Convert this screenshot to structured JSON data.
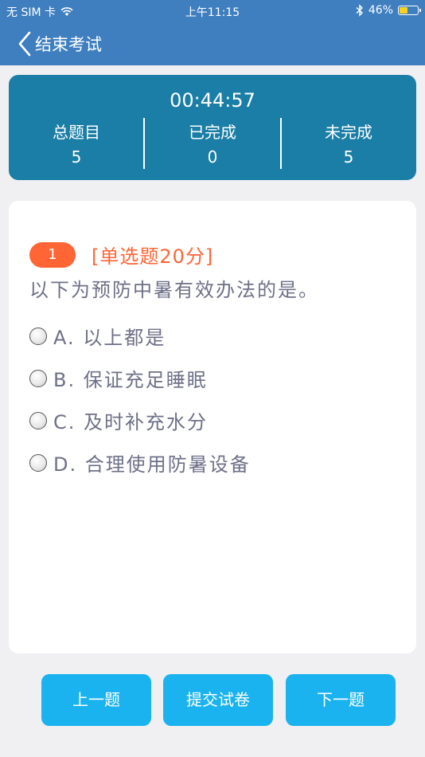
{
  "status_bar": {
    "carrier": "无 SIM 卡",
    "time": "上午11:15",
    "battery_percent": "46%",
    "battery_level": 0.46,
    "icons": [
      "wifi-icon",
      "bluetooth-icon",
      "battery-icon"
    ]
  },
  "nav": {
    "back_label": "结束考试"
  },
  "stats": {
    "timer": "00:44:57",
    "total_label": "总题目",
    "total_value": "5",
    "done_label": "已完成",
    "done_value": "0",
    "remaining_label": "未完成",
    "remaining_value": "5"
  },
  "question": {
    "number": "1",
    "type": "[单选题20分]",
    "text": "以下为预防中暑有效办法的是。",
    "options": [
      {
        "text": "A. 以上都是"
      },
      {
        "text": "B. 保证充足睡眠"
      },
      {
        "text": "C. 及时补充水分"
      },
      {
        "text": "D. 合理使用防暑设备"
      }
    ]
  },
  "buttons": {
    "prev": "上一题",
    "submit": "提交试卷",
    "next": "下一题"
  },
  "colors": {
    "nav_bg": "#3f7fbf",
    "stats_bg": "#1b7ea6",
    "accent_orange": "#ff6535",
    "button_blue": "#1ab3ef",
    "text_gray": "#6e7088"
  }
}
